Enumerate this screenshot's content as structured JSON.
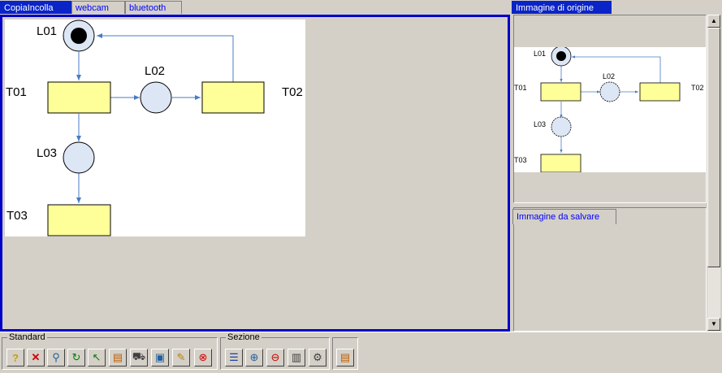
{
  "tabs": [
    {
      "label": "CopiaIncolla",
      "active": true
    },
    {
      "label": "webcam",
      "active": false
    },
    {
      "label": "bluetooth",
      "active": false
    }
  ],
  "right_panel": {
    "origin_title": "Immagine di origine",
    "save_tab": "Immagine da salvare"
  },
  "diagram": {
    "places": [
      "L01",
      "L02",
      "L03"
    ],
    "transitions": [
      "T01",
      "T02",
      "T03"
    ]
  },
  "toolbar": {
    "standard_label": "Standard",
    "section_label": "Sezione",
    "standard_icons": [
      "help-icon",
      "delete-icon",
      "search-icon",
      "refresh-icon",
      "undo-icon",
      "export-icon",
      "cart-icon",
      "image-icon",
      "zoom-icon",
      "stop-icon"
    ],
    "section_icons": [
      "section-list-icon",
      "section-add-icon",
      "section-remove-icon",
      "section-lock-icon",
      "section-settings-icon"
    ],
    "extra_icons": [
      "export-icon"
    ]
  },
  "colors": {
    "accent": "#0a24c8",
    "transition_fill": "#ffff99",
    "place_fill": "#dde6f5",
    "arrow": "#4a7bc4"
  }
}
